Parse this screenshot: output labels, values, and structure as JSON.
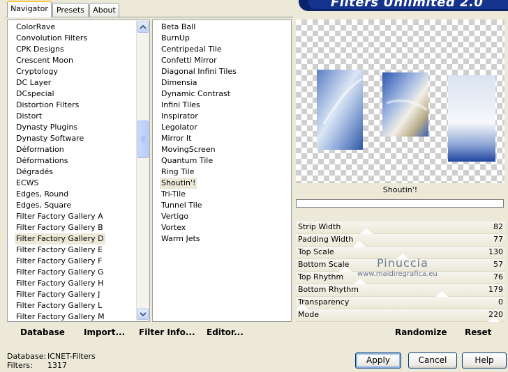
{
  "tabs": [
    "Navigator",
    "Presets",
    "About"
  ],
  "banner_title": "Filters Unlimited 2.0",
  "categories": [
    "ColorRave",
    "Convolution Filters",
    "CPK Designs",
    "Crescent Moon",
    "Cryptology",
    "DC Layer",
    "DCspecial",
    "Distortion Filters",
    "Distort",
    "Dynasty Plugins",
    "Dynasty Software",
    "Déformation",
    "Déformations",
    "Dégradés",
    "ECWS",
    "Edges, Round",
    "Edges, Square",
    "Filter Factory Gallery A",
    "Filter Factory Gallery B",
    "Filter Factory Gallery D",
    "Filter Factory Gallery E",
    "Filter Factory Gallery F",
    "Filter Factory Gallery G",
    "Filter Factory Gallery H",
    "Filter Factory Gallery J",
    "Filter Factory Gallery L",
    "Filter Factory Gallery M"
  ],
  "selected_category": "Filter Factory Gallery D",
  "filters": [
    "Beta Ball",
    "BurnUp",
    "Centripedal Tile",
    "Confetti Mirror",
    "Diagonal Infini Tiles",
    "Dimensia",
    "Dynamic Contrast",
    "Infini Tiles",
    "Inspirator",
    "Legolator",
    "Mirror It",
    "MovingScreen",
    "Quantum Tile",
    "Ring Tile",
    "Shoutin'!",
    "Tri-Tile",
    "Tunnel Tile",
    "Vertigo",
    "Vortex",
    "Warm Jets"
  ],
  "selected_filter": "Shoutin'!",
  "toolbar": {
    "database": "Database",
    "import": "Import...",
    "filter_info": "Filter Info...",
    "editor": "Editor..."
  },
  "preview_filter_name": "Shoutin'!",
  "params": [
    {
      "label": "Strip Width",
      "value": "82"
    },
    {
      "label": "Padding Width",
      "value": "77"
    },
    {
      "label": "Top Scale",
      "value": "130"
    },
    {
      "label": "Bottom Scale",
      "value": "57"
    },
    {
      "label": "Top Rhythm",
      "value": "76"
    },
    {
      "label": "Bottom Rhythm",
      "value": "179"
    },
    {
      "label": "Transparency",
      "value": "0"
    },
    {
      "label": "Mode",
      "value": "220"
    }
  ],
  "randomize": "Randomize",
  "reset": "Reset",
  "watermark": {
    "name": "Pinuccia",
    "site": "www.maidiregrafica.eu"
  },
  "status": {
    "database_label": "Database:",
    "database_value": "ICNET-Filters",
    "filters_label": "Filters:",
    "filters_value": "1317"
  },
  "buttons": {
    "apply": "Apply",
    "cancel": "Cancel",
    "help": "Help"
  },
  "colors": {
    "accent": "#0a246a",
    "tab_highlight": "#ffc83c",
    "panel": "#ece9d8"
  }
}
